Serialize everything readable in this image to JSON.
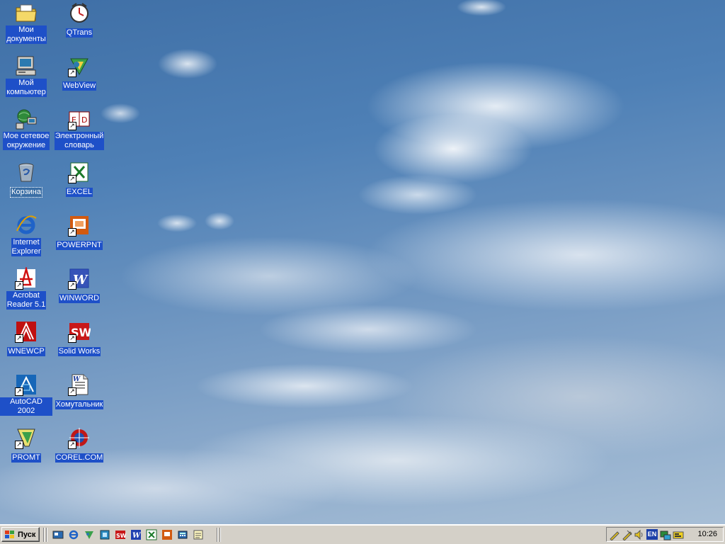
{
  "desktop": {
    "icons": [
      {
        "label": "Мои\nдокументы",
        "icon": "folder-documents-icon"
      },
      {
        "label": "QTrans",
        "icon": "qtrans-icon"
      },
      {
        "label": "Мой\nкомпьютер",
        "icon": "computer-icon"
      },
      {
        "label": "WebView",
        "icon": "webview-icon"
      },
      {
        "label": "Мое сетевое\nокружение",
        "icon": "network-icon"
      },
      {
        "label": "Электронный\nсловарь",
        "icon": "dictionary-icon"
      },
      {
        "label": "Корзина",
        "icon": "recycle-bin-icon"
      },
      {
        "label": "EXCEL",
        "icon": "excel-icon"
      },
      {
        "label": "Internet\nExplorer",
        "icon": "internet-explorer-icon"
      },
      {
        "label": "POWERPNT",
        "icon": "powerpoint-icon"
      },
      {
        "label": "Acrobat\nReader 5.1",
        "icon": "acrobat-icon"
      },
      {
        "label": "WINWORD",
        "icon": "word-icon"
      },
      {
        "label": "WNEWCP",
        "icon": "wnewcp-icon"
      },
      {
        "label": "Solid Works",
        "icon": "solidworks-icon"
      },
      {
        "label": "AutoCAD 2002",
        "icon": "autocad-icon"
      },
      {
        "label": "Хомутальник",
        "icon": "word-document-icon"
      },
      {
        "label": "PROMT",
        "icon": "promt-icon"
      },
      {
        "label": "COREL.COM",
        "icon": "corel-icon"
      }
    ]
  },
  "taskbar": {
    "start_label": "Пуск",
    "language": "EN",
    "clock": "10:26"
  },
  "colors": {
    "selection": "#1e50c8",
    "taskbar": "#d4d0c8"
  }
}
